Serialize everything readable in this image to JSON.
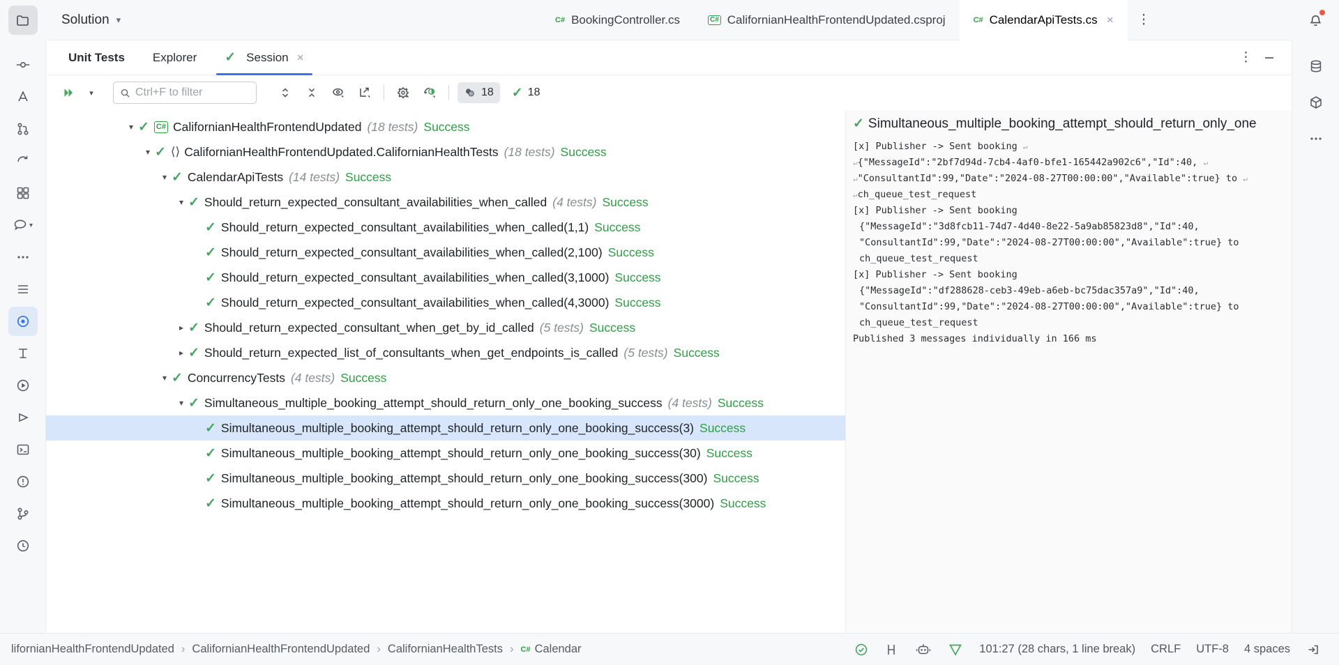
{
  "window": {
    "solution_label": "Solution"
  },
  "editor_tabs": [
    {
      "label": "BookingController.cs",
      "icon": "csharp-icon",
      "selected": false,
      "boxed": false
    },
    {
      "label": "CalifornianHealthFrontendUpdated.csproj",
      "icon": "csharp-icon",
      "selected": false,
      "boxed": true
    },
    {
      "label": "CalendarApiTests.cs",
      "icon": "csharp-icon",
      "selected": true,
      "boxed": false,
      "close": "×"
    }
  ],
  "editor_tabbar": {
    "more_icon": "more-vertical-icon"
  },
  "tool_window": {
    "tabs": [
      {
        "label": "Unit Tests",
        "name": "tab-unit-tests",
        "selected": false,
        "bold": true,
        "check": false
      },
      {
        "label": "Explorer",
        "name": "tab-explorer",
        "selected": false,
        "bold": false,
        "check": false
      },
      {
        "label": "Session",
        "name": "tab-session",
        "selected": true,
        "bold": false,
        "check": true
      }
    ],
    "session_close": "×",
    "options_icon": "more-vertical-icon",
    "minimize_icon": "minimize-icon"
  },
  "toolbar": {
    "run_icon": "run-all-icon",
    "run_dropdown_icon": "chevron-down-icon",
    "search_placeholder": "Ctrl+F to filter",
    "search_value": "",
    "search_icon": "search-icon",
    "expand_collapse_icon": "expand-collapse-icon",
    "collapse_icon": "collapse-all-icon",
    "preview_icon": "eye-icon",
    "export_icon": "export-icon",
    "settings_icon": "gear-icon",
    "coverage_icon": "coverage-icon",
    "badges": [
      {
        "icon": "tests-total-icon",
        "value": "18",
        "shaded": true,
        "name": "badge-total-tests"
      },
      {
        "icon": "check-icon",
        "value": "18",
        "shaded": false,
        "name": "badge-passed-tests"
      }
    ]
  },
  "sidebar_left": {
    "items": [
      {
        "name": "project-folder-icon",
        "active": true
      },
      {
        "name": "commit-icon",
        "active": false
      },
      {
        "name": "ai-assistant-icon",
        "active": false
      },
      {
        "name": "pull-requests-icon",
        "active": false
      },
      {
        "name": "refactor-icon",
        "active": false
      },
      {
        "name": "plugins-icon",
        "active": false
      },
      {
        "name": "chat-icon",
        "active": false
      },
      {
        "name": "more-icon",
        "active": false
      },
      {
        "name": "todo-icon",
        "active": false
      },
      {
        "name": "unit-tests-icon",
        "active": true
      },
      {
        "name": "structure-icon",
        "active": false
      },
      {
        "name": "run-icon",
        "active": false
      },
      {
        "name": "debug-icon",
        "active": false
      },
      {
        "name": "terminal-icon",
        "active": false
      },
      {
        "name": "problems-icon",
        "active": false
      },
      {
        "name": "version-control-icon",
        "active": false
      },
      {
        "name": "database-backup-icon",
        "active": false
      }
    ]
  },
  "sidebar_right": {
    "items": [
      {
        "name": "notifications-icon",
        "badge": true
      },
      {
        "name": "database-icon",
        "badge": false
      },
      {
        "name": "nuget-icon",
        "badge": false
      },
      {
        "name": "more-tool-windows-icon",
        "badge": false
      }
    ]
  },
  "tree": {
    "rows": [
      {
        "indent": 0,
        "arrow": "down",
        "icon": "csharp-project-icon",
        "label": "CalifornianHealthFrontendUpdated",
        "count": "(18 tests)",
        "status": "Success",
        "selected": false
      },
      {
        "indent": 1,
        "arrow": "down",
        "icon": "namespace-icon",
        "label": "CalifornianHealthFrontendUpdated.CalifornianHealthTests",
        "count": "(18 tests)",
        "status": "Success",
        "selected": false
      },
      {
        "indent": 2,
        "arrow": "down",
        "icon": "none",
        "label": "CalendarApiTests",
        "count": "(14 tests)",
        "status": "Success",
        "selected": false
      },
      {
        "indent": 3,
        "arrow": "down",
        "icon": "none",
        "label": "Should_return_expected_consultant_availabilities_when_called",
        "count": "(4 tests)",
        "status": "Success",
        "selected": false
      },
      {
        "indent": 4,
        "arrow": "none",
        "icon": "none",
        "label": "Should_return_expected_consultant_availabilities_when_called(1,1)",
        "count": "",
        "status": "Success",
        "selected": false
      },
      {
        "indent": 4,
        "arrow": "none",
        "icon": "none",
        "label": "Should_return_expected_consultant_availabilities_when_called(2,100)",
        "count": "",
        "status": "Success",
        "selected": false
      },
      {
        "indent": 4,
        "arrow": "none",
        "icon": "none",
        "label": "Should_return_expected_consultant_availabilities_when_called(3,1000)",
        "count": "",
        "status": "Success",
        "selected": false
      },
      {
        "indent": 4,
        "arrow": "none",
        "icon": "none",
        "label": "Should_return_expected_consultant_availabilities_when_called(4,3000)",
        "count": "",
        "status": "Success",
        "selected": false
      },
      {
        "indent": 3,
        "arrow": "right",
        "icon": "none",
        "label": "Should_return_expected_consultant_when_get_by_id_called",
        "count": "(5 tests)",
        "status": "Success",
        "selected": false
      },
      {
        "indent": 3,
        "arrow": "right",
        "icon": "none",
        "label": "Should_return_expected_list_of_consultants_when_get_endpoints_is_called",
        "count": "(5 tests)",
        "status": "Success",
        "selected": false
      },
      {
        "indent": 2,
        "arrow": "down",
        "icon": "none",
        "label": "ConcurrencyTests",
        "count": "(4 tests)",
        "status": "Success",
        "selected": false
      },
      {
        "indent": 3,
        "arrow": "down",
        "icon": "none",
        "label": "Simultaneous_multiple_booking_attempt_should_return_only_one_booking_success",
        "count": "(4 tests)",
        "status": "Success",
        "selected": false
      },
      {
        "indent": 4,
        "arrow": "none",
        "icon": "none",
        "label": "Simultaneous_multiple_booking_attempt_should_return_only_one_booking_success(3)",
        "count": "",
        "status": "Success",
        "selected": true
      },
      {
        "indent": 4,
        "arrow": "none",
        "icon": "none",
        "label": "Simultaneous_multiple_booking_attempt_should_return_only_one_booking_success(30)",
        "count": "",
        "status": "Success",
        "selected": false
      },
      {
        "indent": 4,
        "arrow": "none",
        "icon": "none",
        "label": "Simultaneous_multiple_booking_attempt_should_return_only_one_booking_success(300)",
        "count": "",
        "status": "Success",
        "selected": false
      },
      {
        "indent": 4,
        "arrow": "none",
        "icon": "none",
        "label": "Simultaneous_multiple_booking_attempt_should_return_only_one_booking_success(3000)",
        "count": "",
        "status": "Success",
        "selected": false
      }
    ]
  },
  "output": {
    "title": "Simultaneous_multiple_booking_attempt_should_return_only_one",
    "lines": [
      {
        "text": "[x] Publisher -> Sent booking",
        "wrap_end": true,
        "wrap_start": false
      },
      {
        "text": "{\"MessageId\":\"2bf7d94d-7cb4-4af0-bfe1-165442a902c6\",\"Id\":40,",
        "wrap_end": true,
        "wrap_start": true
      },
      {
        "text": "\"ConsultantId\":99,\"Date\":\"2024-08-27T00:00:00\",\"Available\":true} to",
        "wrap_end": true,
        "wrap_start": true
      },
      {
        "text": "ch_queue_test_request",
        "wrap_end": false,
        "wrap_start": true
      },
      {
        "text": "[x] Publisher -> Sent booking",
        "wrap_end": false,
        "wrap_start": false
      },
      {
        "text": "{\"MessageId\":\"3d8fcb11-74d7-4d40-8e22-5a9ab85823d8\",\"Id\":40,",
        "wrap_end": false,
        "wrap_start": false
      },
      {
        "text": "\"ConsultantId\":99,\"Date\":\"2024-08-27T00:00:00\",\"Available\":true} to",
        "wrap_end": false,
        "wrap_start": false
      },
      {
        "text": "ch_queue_test_request",
        "wrap_end": false,
        "wrap_start": false
      },
      {
        "text": "[x] Publisher -> Sent booking",
        "wrap_end": false,
        "wrap_start": false
      },
      {
        "text": "{\"MessageId\":\"df288628-ceb3-49eb-a6eb-bc75dac357a9\",\"Id\":40,",
        "wrap_end": false,
        "wrap_start": false
      },
      {
        "text": "\"ConsultantId\":99,\"Date\":\"2024-08-27T00:00:00\",\"Available\":true} to",
        "wrap_end": false,
        "wrap_start": false
      },
      {
        "text": "ch_queue_test_request",
        "wrap_end": false,
        "wrap_start": false
      },
      {
        "text": "Published 3 messages individually in 166 ms",
        "wrap_end": false,
        "wrap_start": false
      }
    ]
  },
  "status_bar": {
    "breadcrumbs": [
      "lifornianHealthFrontendUpdated",
      "CalifornianHealthFrontendUpdated",
      "CalifornianHealthTests",
      "Calendar"
    ],
    "breadcrumb_last_icon": "csharp-icon",
    "separator": "›",
    "right_icons": [
      {
        "name": "inspections-ok-icon"
      },
      {
        "name": "code-vision-icon"
      },
      {
        "name": "ai-assistant-status-icon"
      },
      {
        "name": "resharper-icon"
      }
    ],
    "caret_position": "101:27 (28 chars, 1 line break)",
    "line_separator": "CRLF",
    "encoding": "UTF-8",
    "indent": "4 spaces",
    "exit_icon": "logout-icon"
  },
  "colors": {
    "accent": "#3574f0",
    "success": "#2f9e44",
    "selection": "#d7e6fb",
    "notification": "#e8594a"
  }
}
